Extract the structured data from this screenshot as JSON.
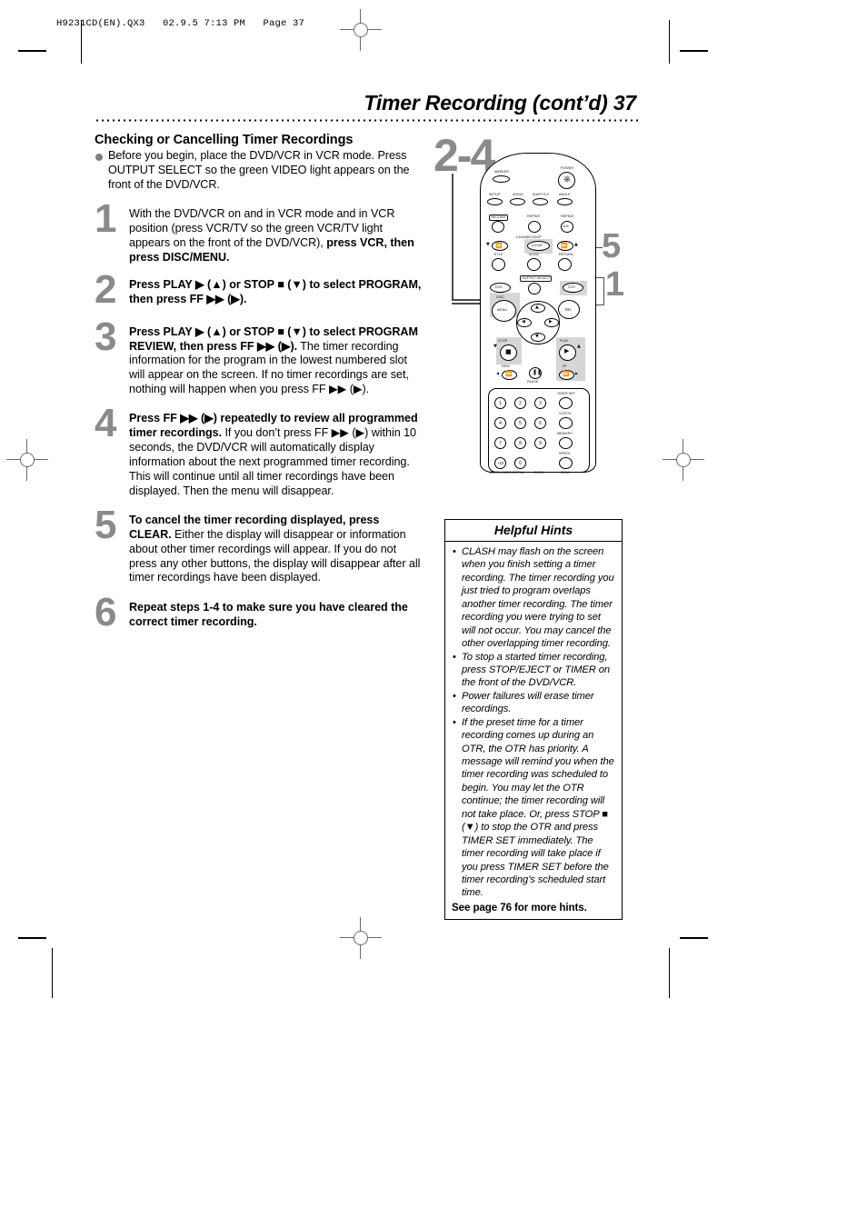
{
  "print_marks": {
    "header_line": "H9231CD(EN).QX3   02.9.5 7:13 PM   Page 37"
  },
  "header": {
    "title": "Timer Recording (cont’d)  37"
  },
  "section": {
    "heading": "Checking or Cancelling Timer Recordings",
    "intro": "Before you begin, place the DVD/VCR in VCR mode. Press OUTPUT SELECT so the green VIDEO light appears on the front of the DVD/VCR."
  },
  "steps": [
    {
      "number": "1",
      "text_plain": "With the DVD/VCR on and in VCR mode and in VCR position (press VCR/TV so the green VCR/TV light appears on the front of the DVD/VCR), ",
      "text_bold": "press VCR, then press DISC/MENU."
    },
    {
      "number": "2",
      "text_bold": "Press PLAY ▶ (▲) or STOP ■ (▼) to select PROGRAM, then press FF ▶▶ (▶).",
      "text_plain": ""
    },
    {
      "number": "3",
      "text_bold": "Press PLAY ▶ (▲) or STOP ■ (▼) to select PROGRAM REVIEW, then press FF ▶▶ (▶).",
      "text_plain": " The timer recording information for the program in the lowest numbered slot will appear on the screen. If no timer recordings are set, nothing will happen when you press FF ▶▶ (▶)."
    },
    {
      "number": "4",
      "text_bold": "Press FF ▶▶ (▶) repeatedly to review all programmed timer recordings.",
      "text_plain": " If you don’t press FF ▶▶ (▶) within 10 seconds, the DVD/VCR will automatically display information about the next programmed timer recording. This will continue until all timer recordings have been displayed. Then the menu will disappear."
    },
    {
      "number": "5",
      "text_bold": "To cancel the timer recording displayed, press CLEAR.",
      "text_plain": " Either the display will disappear or information about other timer recordings will appear. If you do not press any other buttons, the display will disappear after all timer recordings have been displayed."
    },
    {
      "number": "6",
      "text_bold": "Repeat steps 1-4 to make sure you have cleared the correct timer recording.",
      "text_plain": ""
    }
  ],
  "callouts": {
    "top": "2-4",
    "middle": "5",
    "bottom": "1"
  },
  "remote": {
    "labels": {
      "marker": "MARKER",
      "power": "POWER",
      "setup": "SETUP",
      "audio": "AUDIO",
      "subtitle": "SUBTITLE",
      "angle": "ANGLE",
      "record": "RECORD",
      "repeat": "REPEAT",
      "repeat_ab": "REPEAT",
      "repeat_ab_inner": "A-B",
      "channel_skip": "CHANNEL/SKIP",
      "clear": "CLEAR",
      "title": "TITLE",
      "mode": "MODE",
      "return": "RETURN",
      "output_select": "OUTPUT SELECT",
      "dvd": "DVD",
      "vcr": "VCR",
      "disc": "DISC",
      "menu": "MENU",
      "ok": "OK",
      "stop": "STOP",
      "play": "PLAY",
      "rew": "REW",
      "pause": "PAUSE",
      "ff": "FF",
      "timer_set": "TIMER SET",
      "vcr_tv": "VCR/TV",
      "memory": "MEMORY",
      "speed": "SPEED",
      "slow": "SLOW",
      "search_mode": "SEARCH MODE",
      "display": "DISPLAY",
      "zoom": "ZOOM"
    },
    "keypad": [
      "1",
      "2",
      "3",
      "4",
      "5",
      "6",
      "7",
      "8",
      "9",
      "+10",
      "0"
    ]
  },
  "hints": {
    "title": "Helpful Hints",
    "items": [
      "CLASH may flash on the screen when you finish setting a timer recording. The timer recording you just tried to program overlaps another timer recording. The timer recording you were trying to set will not occur. You may cancel the other overlapping timer recording.",
      "To stop a started timer recording, press STOP/EJECT or TIMER on the front of the DVD/VCR.",
      "Power failures will erase timer recordings.",
      "If the preset time for a timer recording comes up during an OTR, the OTR has priority. A message will remind you when the timer recording was scheduled to begin. You may let the OTR continue; the timer recording will not take place. Or, press STOP ■ (▼) to stop the OTR and press TIMER SET immediately. The timer recording will take place if you press TIMER SET before the timer recording’s scheduled start time."
    ],
    "bullet": "•",
    "footer": "See page 76 for more hints."
  }
}
